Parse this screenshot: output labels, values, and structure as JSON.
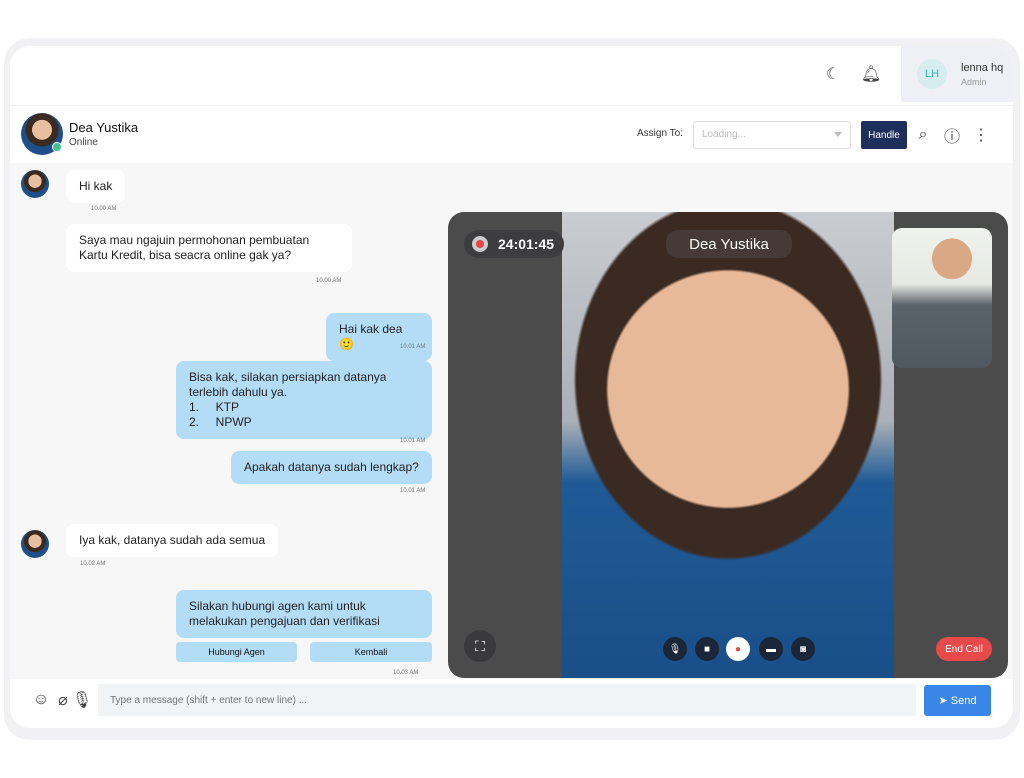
{
  "topbar": {
    "theme_icon": "moon-icon",
    "notifications_icon": "bell-icon",
    "user": {
      "initials": "LH",
      "name": "lenna hq",
      "role": "Admin"
    }
  },
  "chat_header": {
    "name": "Dea Yustika",
    "status": "Online",
    "assign_label": "Assign To:",
    "assign_placeholder": "Loading...",
    "handle_label": "Handle"
  },
  "messages": [
    {
      "from": "customer",
      "text": "Hi kak",
      "time": "10.00 AM"
    },
    {
      "from": "customer",
      "text": "Saya mau ngajuin permohonan pembuatan Kartu Kredit, bisa seacra online gak ya?",
      "time": "10.00 AM"
    },
    {
      "from": "agent",
      "text": "Hai kak dea 🙂",
      "time": "10.01 AM"
    },
    {
      "from": "agent",
      "text": "Bisa kak, silakan persiapkan datanya terlebih dahulu ya.",
      "list": [
        "1.     KTP",
        "2.     NPWP"
      ],
      "time": "10.01 AM"
    },
    {
      "from": "agent",
      "text": "Apakah datanya sudah lengkap?",
      "time": "10.01 AM"
    },
    {
      "from": "customer",
      "text": "Iya kak, datanya sudah ada semua",
      "time": "10.02 AM"
    },
    {
      "from": "agent",
      "text": "Silakan hubungi agen kami untuk melakukan pengajuan dan verifikasi",
      "buttons": [
        "Hubungi Agen",
        "Kembali"
      ],
      "time": "10.03 AM"
    }
  ],
  "video_call": {
    "timer": "24:01:45",
    "caller_name": "Dea Yustika",
    "end_label": "End Call",
    "colors": {
      "end": "#e84a4a",
      "record": "#e74545"
    }
  },
  "composer": {
    "placeholder": "Type a message (shift + enter to new line) ...",
    "send_label": "Send"
  },
  "colors": {
    "agent_bubble": "#b3dcf7",
    "handle_button": "#1e2f5c",
    "send_button": "#3a86e8",
    "online": "#47c08f"
  }
}
